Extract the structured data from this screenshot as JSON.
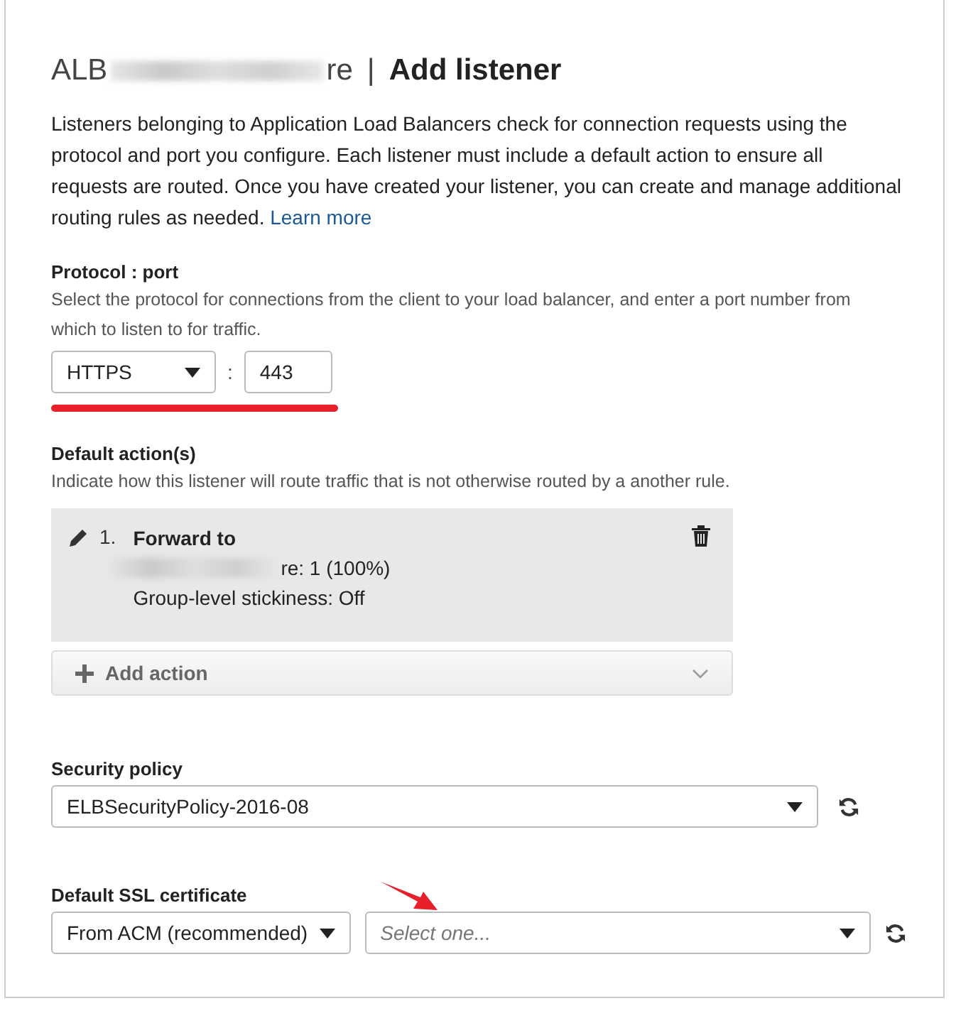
{
  "header": {
    "title_start": "ALB",
    "title_end": "re",
    "title_redacted": true,
    "separator": "|",
    "heading": "Add listener"
  },
  "intro": {
    "text": "Listeners belonging to Application Load Balancers check for connection requests using the protocol and port you configure. Each listener must include a default action to ensure all requests are routed. Once you have created your listener, you can create and manage additional routing rules as needed.",
    "link": "Learn more"
  },
  "protocol_port": {
    "label": "Protocol : port",
    "help": "Select the protocol for connections from the client to your load balancer, and enter a port number from which to listen to for traffic.",
    "protocol": "HTTPS",
    "separator": ":",
    "port": "443",
    "underlined": true
  },
  "default_actions": {
    "label": "Default action(s)",
    "help": "Indicate how this listener will route traffic that is not otherwise routed by a another rule.",
    "actions": [
      {
        "number": "1.",
        "title": "Forward to",
        "target_end": "re: 1 (100%)",
        "target_redacted": true,
        "stickiness": "Group-level stickiness: Off"
      }
    ],
    "add_button": "Add action"
  },
  "security_policy": {
    "label": "Security policy",
    "value": "ELBSecurityPolicy-2016-08"
  },
  "ssl_certificate": {
    "label": "Default SSL certificate",
    "source": "From ACM (recommended)",
    "placeholder": "Select one...",
    "arrow_pointer": true
  }
}
